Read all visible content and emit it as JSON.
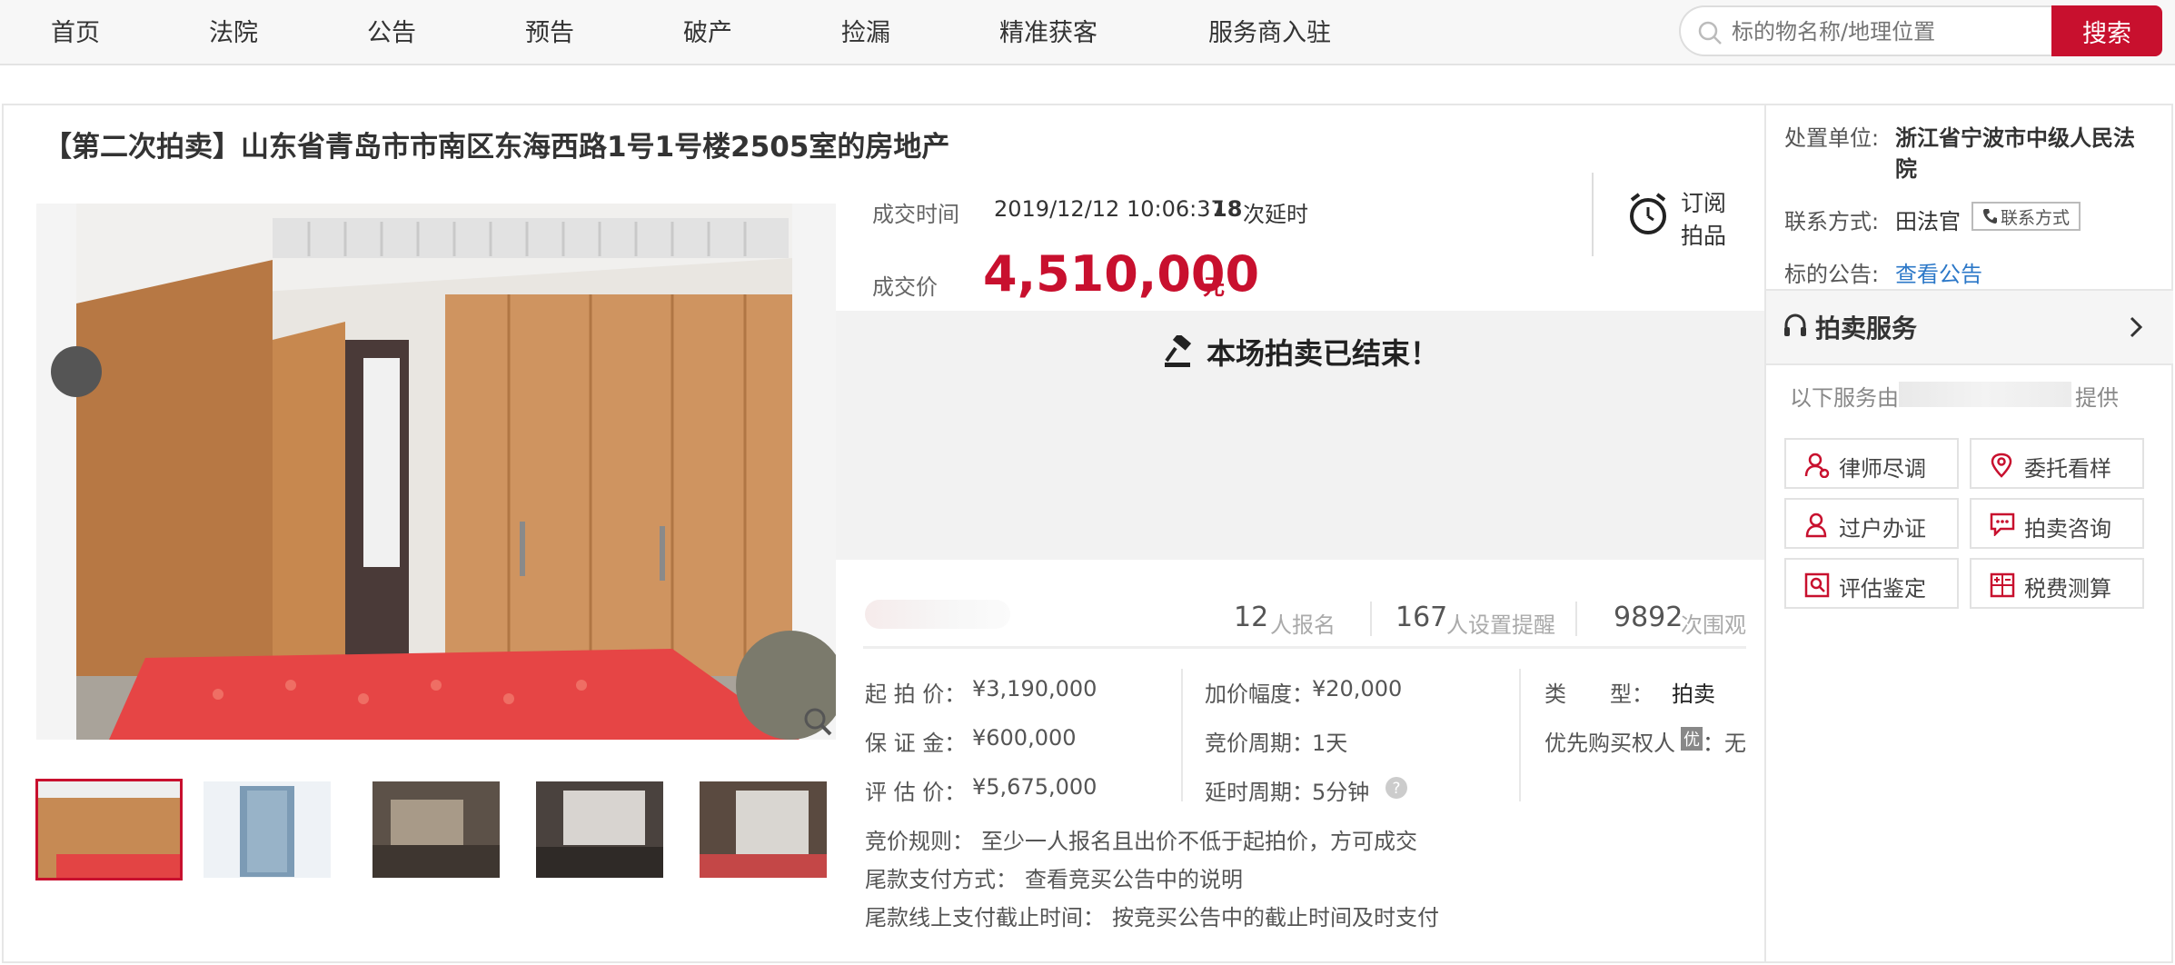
{
  "nav": {
    "items": [
      "首页",
      "法院",
      "公告",
      "预告",
      "破产",
      "捡漏",
      "精准获客",
      "服务商入驻"
    ],
    "search_placeholder": "标的物名称/地理位置",
    "search_button": "搜索"
  },
  "title": "【第二次拍卖】山东省青岛市市南区东海西路1号1号楼2505室的房地产",
  "deal": {
    "time_label": "成交时间",
    "time_value": "2019/12/12 10:06:37",
    "delay_count": "18",
    "delay_suffix": "次延时",
    "price_label": "成交价",
    "price": "4,510,000",
    "price_unit": "元",
    "subscribe_line1": "订阅",
    "subscribe_line2": "拍品",
    "ended_text": "本场拍卖已结束！"
  },
  "stats": {
    "signups": "12",
    "signups_unit": "人报名",
    "reminders": "167",
    "reminders_unit": "人设置提醒",
    "views": "9892",
    "views_unit": "次围观"
  },
  "terms": {
    "start_price_label": "起 拍 价：",
    "start_price": "¥3,190,000",
    "deposit_label": "保 证 金：",
    "deposit": "¥600,000",
    "appraisal_label": "评 估 价：",
    "appraisal": "¥5,675,000",
    "increment_label": "加价幅度：",
    "increment": "¥20,000",
    "cycle_label": "竞价周期：",
    "cycle": "1天",
    "delay_period_label": "延时周期：",
    "delay_period": "5分钟",
    "type_label": "类　　型：",
    "type": "拍卖",
    "priority_label": "优先购买权人",
    "priority_badge": "优",
    "priority_value": "：无",
    "rule_label": "竞价规则：",
    "rule": "至少一人报名且出价不低于起拍价，方可成交",
    "payment_label": "尾款支付方式：",
    "payment": "查看竞买公告中的说明",
    "deadline_label": "尾款线上支付截止时间：",
    "deadline": "按竞买公告中的截止时间及时支付"
  },
  "sidebar": {
    "court_label": "处置单位:",
    "court_line1": "浙江省宁波市中级人民法",
    "court_line2": "院",
    "contact_label": "联系方式:",
    "contact_name": "田法官",
    "contact_button": "联系方式",
    "notice_label": "标的公告:",
    "notice_link": "查看公告",
    "services_title": "拍卖服务",
    "provider_prefix": "以下服务由",
    "provider_suffix": "提供",
    "services": [
      "律师尽调",
      "委托看样",
      "过户办证",
      "拍卖咨询",
      "评估鉴定",
      "税费测算"
    ]
  },
  "colors": {
    "accent": "#c8102e",
    "link": "#2c78c8"
  }
}
